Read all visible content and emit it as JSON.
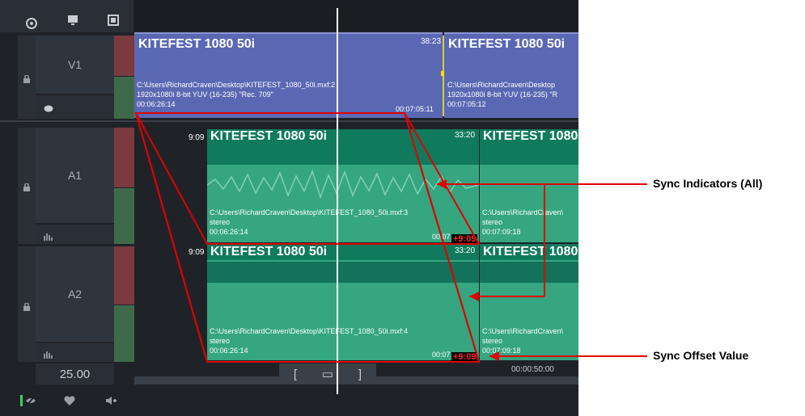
{
  "toolbar": {
    "icons": [
      "eye-icon",
      "monitor-icon",
      "film-icon"
    ]
  },
  "tracks": {
    "v1": {
      "name": "V1"
    },
    "a1": {
      "name": "A1"
    },
    "a2": {
      "name": "A2"
    }
  },
  "fps": "25.00",
  "video_clips": [
    {
      "title": "KITEFEST 1080 50i",
      "tc_right": "38:23",
      "path": "C:\\Users\\RichardCraven\\Desktop\\KITEFEST_1080_50i.mxf:2",
      "format": "1920x1080i 8-bit YUV (16-235) \"Rec. 709\"",
      "tc_in": "00:06:26:14",
      "tc_out": "00:07:05:11"
    },
    {
      "title": "KITEFEST 1080 50i",
      "path": "C:\\Users\\RichardCraven\\Desktop",
      "format": "1920x1080i 8-bit YUV (16-235) \"R",
      "tc_in": "00:07:05:12"
    }
  ],
  "audio_a1": [
    {
      "title": "KITEFEST 1080 50i",
      "tc_left": "9:09",
      "tc_right": "33:20",
      "path": "C:\\Users\\RichardCraven\\Desktop\\KITEFEST_1080_50i.mxf:3",
      "channels": "stereo",
      "tc_in": "00:06:26:14",
      "tc_out": "00:07",
      "offset": "+9:09"
    },
    {
      "title": "KITEFEST 1080",
      "path": "C:\\Users\\RichardCraven\\",
      "channels": "stereo",
      "tc_in": "00:07:09:18"
    }
  ],
  "audio_a2": [
    {
      "title": "KITEFEST 1080 50i",
      "tc_left": "9:09",
      "tc_right": "33:20",
      "path": "C:\\Users\\RichardCraven\\Desktop\\KITEFEST_1080_50i.mxf:4",
      "channels": "stereo",
      "tc_in": "00:06:26:14",
      "tc_out": "00:07",
      "offset": "+9:09"
    },
    {
      "title": "KITEFEST 1080",
      "path": "C:\\Users\\RichardCraven\\",
      "channels": "stereo",
      "tc_in": "00:07:09:18"
    }
  ],
  "ruler_timecode": "00:00:50:00",
  "trim_buttons": {
    "left": "[",
    "mid": "▭",
    "right": "]"
  },
  "callouts": {
    "sync_indicators": "Sync Indicators (All)",
    "sync_offset": "Sync Offset Value"
  },
  "colors": {
    "video": "#5a68b3",
    "audio": "#35a680",
    "callout": "#e00000",
    "timecode_offset": "#ff2a2a"
  }
}
